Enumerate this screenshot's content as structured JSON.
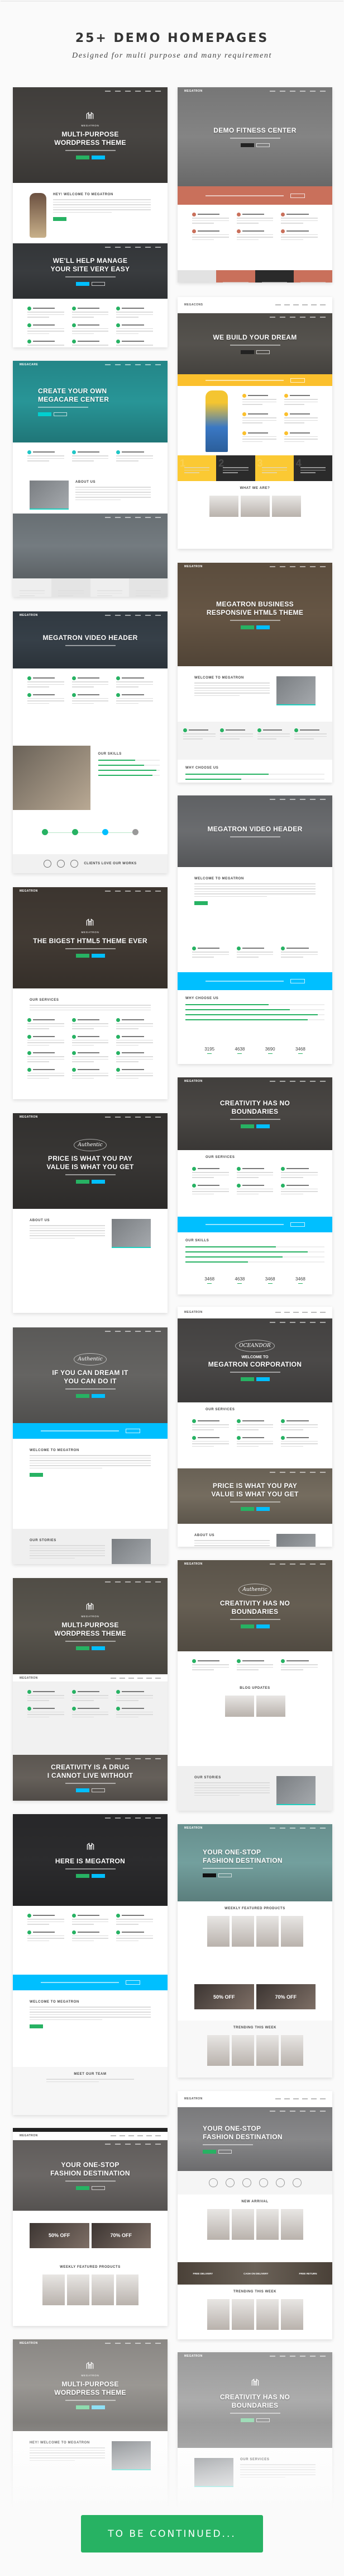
{
  "header": {
    "title": "25+ DEMO HOMEPAGES",
    "subtitle": "Designed for multi purpose and many requirement"
  },
  "colors": {
    "green": "#27b263",
    "blue": "#00bfff",
    "salmon": "#c9705b",
    "yellow": "#fbc02d",
    "teal": "#1fc6c6"
  },
  "left_column": [
    {
      "sections": [
        {
          "type": "hero",
          "bg": "#4b4845",
          "logo": "MEGATRON",
          "title": "MULTI-PURPOSE\nWORDPRESS THEME",
          "buttons": [
            "#27b263",
            "#00bfff"
          ]
        },
        {
          "type": "welcome",
          "heading": "HEY! WELCOME TO MEGATRON",
          "image": "person",
          "button": "#27b263"
        },
        {
          "type": "hero",
          "bg": "#3c3f42",
          "title": "WE'LL HELP MANAGE\nYOUR SITE VERY EASY",
          "buttons": [
            "#00bfff",
            "outline"
          ]
        },
        {
          "type": "features",
          "accent": "#27b263",
          "count": 9
        }
      ]
    },
    {
      "sections": [
        {
          "type": "hero",
          "bg": "#2a9d9f",
          "brand": "MEGACARE",
          "align": "left",
          "title": "CREATE YOUR OWN\nMEGACARE CENTER",
          "buttons": [
            "#00d0d0",
            "outline"
          ]
        },
        {
          "type": "features",
          "accent": "#1fc6c6",
          "count": 3
        },
        {
          "type": "welcome",
          "heading": "ABOUT US",
          "image": "left"
        },
        {
          "type": "hero",
          "bg": "#7a8287",
          "title": ""
        },
        {
          "type": "cols4",
          "colors": [
            "#eeeeee",
            "#e4e4e4",
            "#eeeeee",
            "#e4e4e4"
          ]
        }
      ]
    },
    {
      "sections": [
        {
          "type": "hero",
          "bg": "#39434c",
          "brand": "MEGATRON",
          "title": "MEGATRON VIDEO HEADER"
        },
        {
          "type": "features",
          "accent": "#27b263",
          "count": 6
        },
        {
          "type": "skills",
          "heading": "OUR SKILLS",
          "levels": [
            0.6,
            0.75,
            0.95,
            0.88
          ]
        },
        {
          "type": "steps",
          "colors": [
            "#27b263",
            "#27b263",
            "#00bfff",
            "#999999"
          ]
        },
        {
          "type": "clients",
          "text": "CLIENTS LOVE OUR WORKS"
        }
      ]
    },
    {
      "sections": [
        {
          "type": "hero",
          "bg": "#463e37",
          "brand": "MEGATRON",
          "logo": "MEGATRON",
          "title": "THE BIGEST HTML5 THEME EVER",
          "buttons": [
            "#27b263",
            "#00bfff"
          ]
        },
        {
          "type": "welcome",
          "heading": "OUR SERVICES"
        },
        {
          "type": "features",
          "accent": "#27b263",
          "count": 12
        }
      ]
    },
    {
      "sections": [
        {
          "type": "hero",
          "bg": "#3b3937",
          "brand": "MEGATRON",
          "badge": "Authentic",
          "title": "PRICE IS WHAT YOU PAY\nVALUE IS WHAT YOU GET",
          "buttons": [
            "#27b263",
            "#00bfff"
          ]
        },
        {
          "type": "welcome",
          "heading": "ABOUT US",
          "image": "right"
        }
      ]
    },
    {
      "sections": [
        {
          "type": "hero",
          "bg": "#6a6967",
          "badge": "Authentic",
          "title": "IF YOU CAN DREAM IT\nYOU CAN DO IT",
          "buttons": [
            "#27b263",
            "#00bfff"
          ]
        },
        {
          "type": "band",
          "color": "#00bfff"
        },
        {
          "type": "welcome",
          "heading": "WELCOME TO MEGATRON",
          "button": "#27b263"
        },
        {
          "type": "welcome",
          "heading": "OUR STORIES",
          "image": "right",
          "bg": "#efefef"
        }
      ]
    },
    {
      "sections": [
        {
          "type": "hero",
          "bg": "#5e5a52",
          "logo": "MEGATRON",
          "title": "MULTI-PURPOSE\nWORDPRESS THEME",
          "buttons": [
            "#27b263",
            "#00bfff"
          ]
        },
        {
          "type": "nav",
          "brand": "MEGATRON"
        },
        {
          "type": "features",
          "accent": "#27b263",
          "count": 6,
          "bg": "#f1f1f1"
        },
        {
          "type": "hero",
          "bg": "#6b655f",
          "title": "CREATIVITY IS A DRUG\nI CANNOT LIVE WITHOUT",
          "buttons": [
            "#00bfff",
            "outline"
          ]
        }
      ]
    },
    {
      "sections": [
        {
          "type": "hero",
          "bg": "#2e2e30",
          "logo": "",
          "title": "HERE IS MEGATRON",
          "buttons": [
            "#27b263",
            "#00bfff"
          ]
        },
        {
          "type": "features",
          "accent": "#27b263",
          "count": 6
        },
        {
          "type": "band",
          "color": "#00bfff"
        },
        {
          "type": "welcome",
          "heading": "WELCOME TO MEGATRON",
          "button": "#27b263"
        },
        {
          "type": "products",
          "heading": "MEET OUR TEAM",
          "count": 0,
          "bg": "#f6f6f6"
        }
      ]
    },
    {
      "sections": [
        {
          "type": "topbar"
        },
        {
          "type": "nav",
          "brand": "MEGATRON"
        },
        {
          "type": "hero",
          "bg": "#716d6b",
          "title": "YOUR ONE-STOP\nFASHION DESTINATION",
          "buttons": [
            "#27b263",
            "outline"
          ]
        },
        {
          "type": "offers",
          "items": [
            "50% OFF",
            "70% OFF"
          ]
        },
        {
          "type": "products",
          "heading": "WEEKLY FEATURED PRODUCTS",
          "count": 4
        }
      ]
    },
    {
      "sections": [
        {
          "type": "hero",
          "bg": "#a29f9b",
          "brand": "MEGATRON",
          "logo": "MEGATRON",
          "title": "MULTI-PURPOSE\nWORDPRESS THEME",
          "buttons": [
            "#8fdcaf",
            "#8fe0f5"
          ]
        },
        {
          "type": "welcome",
          "heading": "HEY! WELCOME TO MEGATRON",
          "image": "right"
        }
      ]
    }
  ],
  "right_column": [
    {
      "sections": [
        {
          "type": "hero",
          "bg": "#8b8b8b",
          "brand": "MEGATRON",
          "title": "DEMO FITNESS CENTER",
          "buttons": [
            "#222222",
            "outline"
          ]
        },
        {
          "type": "band",
          "color": "#c9705b"
        },
        {
          "type": "features",
          "accent": "#c9705b",
          "count": 6
        },
        {
          "type": "cols4",
          "colors": [
            "#e2e2e2",
            "#c9705b",
            "#2a2a2a",
            "#c9705b"
          ]
        }
      ]
    },
    {
      "sections": [
        {
          "type": "nav",
          "brand": "MEGACONS"
        },
        {
          "type": "hero",
          "bg": "#5a5752",
          "title": "WE BUILD YOUR DREAM",
          "buttons": [
            "#222222",
            "outline"
          ]
        },
        {
          "type": "band",
          "color": "#fbc02d"
        },
        {
          "type": "features",
          "accent": "#fbc02d",
          "count": 6,
          "image": "worker"
        },
        {
          "type": "cols4",
          "colors": [
            "#fbc933",
            "#2b2b2b",
            "#fbc933",
            "#2b2b2b"
          ],
          "numbers": [
            "1",
            "2",
            "3",
            "4"
          ]
        },
        {
          "type": "products",
          "heading": "WHAT WE ARE?",
          "count": 3
        }
      ]
    },
    {
      "sections": [
        {
          "type": "hero",
          "bg": "#6b5a48",
          "brand": "MEGATRON",
          "title": "MEGATRON BUSINESS\nRESPONSIVE HTML5 THEME",
          "buttons": [
            "#27b263",
            "#00bfff"
          ]
        },
        {
          "type": "welcome",
          "heading": "WELCOME TO MEGATRON",
          "image": "right"
        },
        {
          "type": "features",
          "accent": "#27b263",
          "count": 4,
          "cols": 4,
          "bg": "#f3f3f3"
        },
        {
          "type": "skills",
          "heading": "WHY CHOOSE US",
          "levels": [
            0.6,
            0.4
          ],
          "noimage": true
        }
      ]
    },
    {
      "sections": [
        {
          "type": "hero",
          "bg": "#707275",
          "title": "MEGATRON VIDEO HEADER"
        },
        {
          "type": "welcome",
          "heading": "WELCOME TO MEGATRON",
          "button": "#27b263"
        },
        {
          "type": "features",
          "accent": "#27b263",
          "count": 3
        },
        {
          "type": "band",
          "color": "#00bfff"
        },
        {
          "type": "skills",
          "heading": "WHY CHOOSE US",
          "levels": [
            0.6,
            0.75,
            0.95,
            0.88
          ],
          "noimage": true
        },
        {
          "type": "stats",
          "values": [
            "3195",
            "4638",
            "3690",
            "3468"
          ]
        }
      ]
    },
    {
      "sections": [
        {
          "type": "hero",
          "bg": "#4d4a47",
          "brand": "MEGATRON",
          "title": "CREATIVITY HAS NO\nBOUNDARIES",
          "buttons": [
            "#27b263",
            "#00bfff"
          ]
        },
        {
          "type": "features",
          "accent": "#27b263",
          "count": 6,
          "heading": "OUR SERVICES"
        },
        {
          "type": "band",
          "color": "#00bfff"
        },
        {
          "type": "skills",
          "heading": "OUR SKILLS",
          "levels": [
            0.65,
            0.88,
            0.7,
            0.45
          ],
          "noimage": true
        },
        {
          "type": "stats",
          "values": [
            "3468",
            "4638",
            "3468",
            "3468"
          ]
        }
      ]
    },
    {
      "sections": [
        {
          "type": "nav",
          "brand": "MEGATRON"
        },
        {
          "type": "hero",
          "bg": "#4f4d4c",
          "badge": "OCEANDOR",
          "pre": "WELCOME TO",
          "title": "MEGATRON CORPORATION",
          "buttons": [
            "#27b263",
            "#00bfff"
          ]
        },
        {
          "type": "features",
          "accent": "#27b263",
          "count": 6,
          "heading": "OUR SERVICES"
        },
        {
          "type": "hero",
          "bg": "#7b7264",
          "title": "PRICE IS WHAT YOU PAY\nVALUE IS WHAT YOU GET",
          "buttons": [
            "#27b263",
            "#00bfff"
          ]
        },
        {
          "type": "welcome",
          "heading": "ABOUT US",
          "image": "right"
        }
      ]
    },
    {
      "sections": [
        {
          "type": "hero",
          "bg": "#6b6357",
          "brand": "MEGATRON",
          "badge": "Authentic",
          "title": "CREATIVITY HAS NO\nBOUNDARIES",
          "buttons": [
            "#27b263",
            "#00bfff"
          ]
        },
        {
          "type": "features",
          "accent": "#27b263",
          "count": 3
        },
        {
          "type": "products",
          "heading": "BLOG UPDATES",
          "count": 2
        },
        {
          "type": "welcome",
          "heading": "OUR STORIES",
          "image": "right",
          "bg": "#efefef"
        }
      ]
    },
    {
      "sections": [
        {
          "type": "hero",
          "bg": "#79a8a6",
          "brand": "MEGATRON",
          "align": "left",
          "title": "YOUR ONE-STOP\nFASHION DESTINATION",
          "buttons": [
            "#111111",
            "outline"
          ]
        },
        {
          "type": "products",
          "heading": "WEEKLY FEATURED PRODUCTS",
          "count": 4
        },
        {
          "type": "offers",
          "items": [
            "50% OFF",
            "70% OFF"
          ]
        },
        {
          "type": "products",
          "heading": "TRENDING THIS WEEK",
          "count": 4,
          "bg": "#f8f8f8"
        }
      ]
    },
    {
      "sections": [
        {
          "type": "nav",
          "brand": "MEGATRON"
        },
        {
          "type": "hero",
          "bg": "#8f8f91",
          "align": "left",
          "title": "YOUR ONE-STOP\nFASHION DESTINATION",
          "buttons": [
            "#27b263",
            "outline"
          ]
        },
        {
          "type": "logos",
          "count": 6
        },
        {
          "type": "products",
          "heading": "NEW ARRIVAL",
          "count": 4
        },
        {
          "type": "delivery",
          "items": [
            "FREE DELIVERY",
            "CASH ON DELIVERY",
            "FREE RETURN"
          ]
        },
        {
          "type": "products",
          "heading": "TRENDING THIS WEEK",
          "count": 4
        }
      ]
    },
    {
      "sections": [
        {
          "type": "hero",
          "bg": "#b5b5b5",
          "brand": "MEGATRON",
          "logo": "",
          "title": "CREATIVITY HAS NO\nBOUNDARIES",
          "buttons": [
            "#9fdcb8",
            "outline"
          ]
        },
        {
          "type": "welcome",
          "heading": "OUR SERVICES",
          "image": "left"
        }
      ]
    }
  ],
  "cta": {
    "label": "TO BE CONTINUED..."
  }
}
